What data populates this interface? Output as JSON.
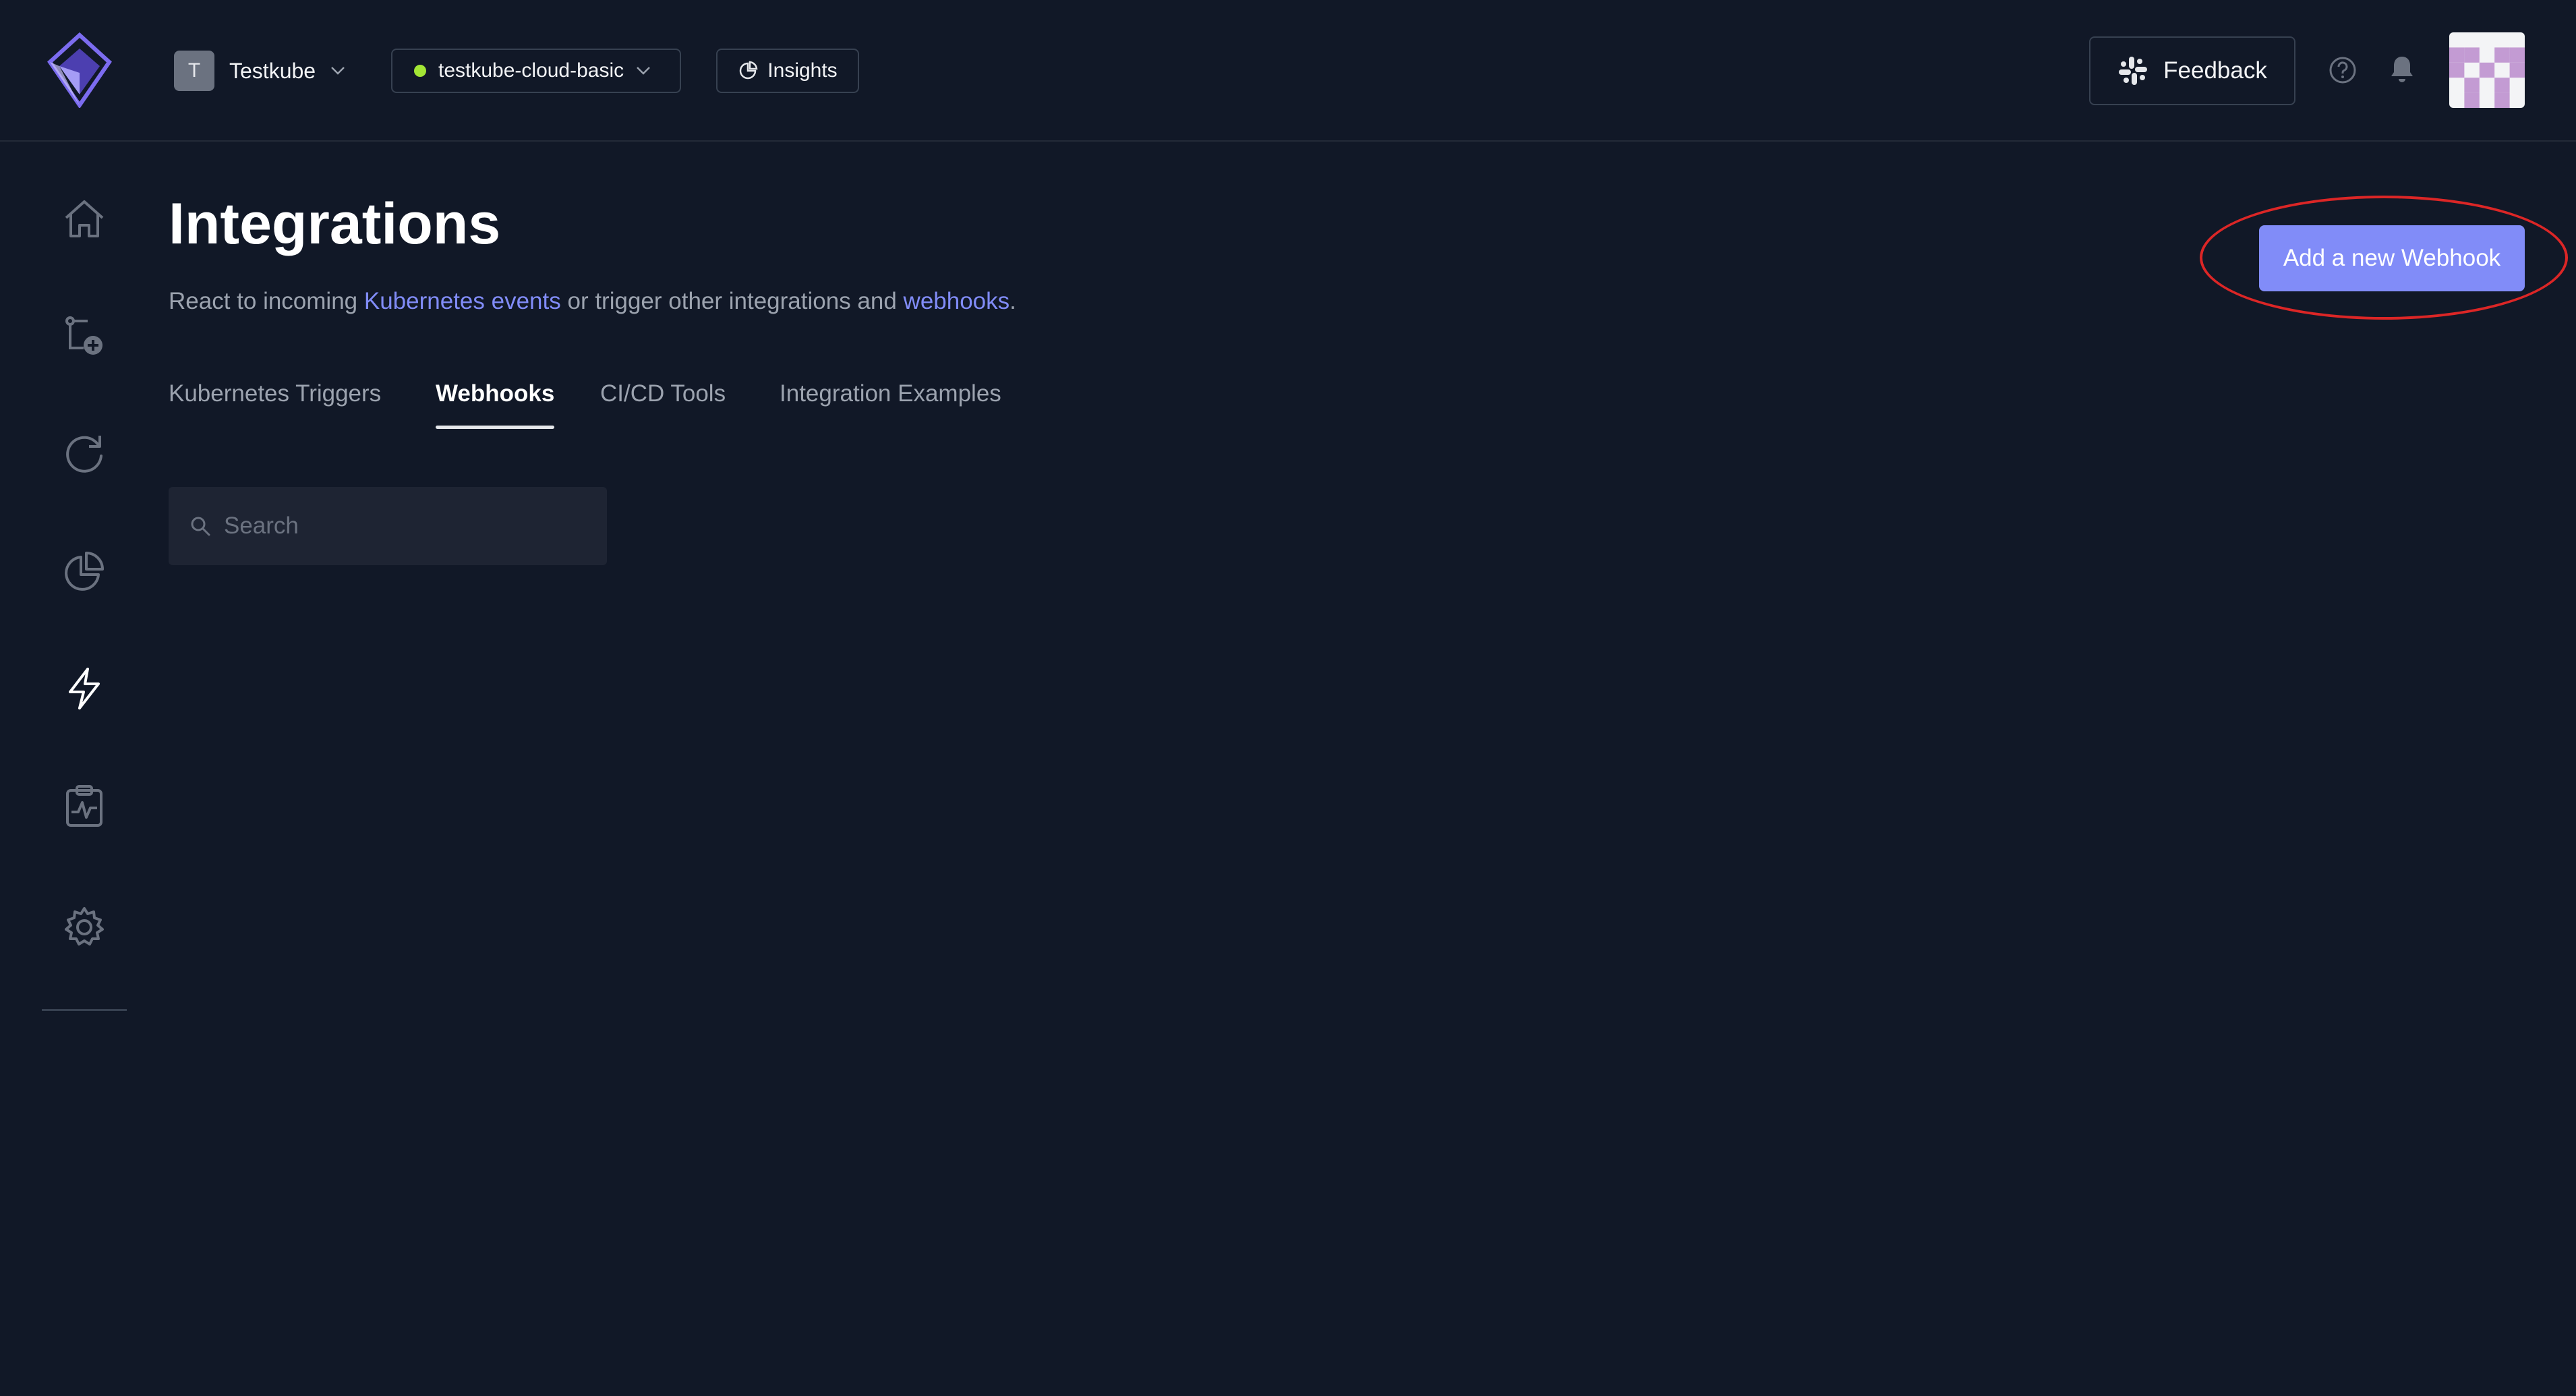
{
  "header": {
    "org": {
      "initial": "T",
      "name": "Testkube"
    },
    "environment": {
      "name": "testkube-cloud-basic",
      "status_color": "#a3e635"
    },
    "insights_label": "Insights",
    "feedback_label": "Feedback"
  },
  "sidebar": {
    "items": [
      {
        "name": "home",
        "icon": "home-icon"
      },
      {
        "name": "tests",
        "icon": "add-test-icon"
      },
      {
        "name": "executions",
        "icon": "refresh-icon"
      },
      {
        "name": "analytics",
        "icon": "pie-chart-icon"
      },
      {
        "name": "integrations",
        "icon": "lightning-icon",
        "active": true
      },
      {
        "name": "status",
        "icon": "clipboard-pulse-icon"
      },
      {
        "name": "settings",
        "icon": "gear-icon"
      }
    ]
  },
  "main": {
    "title": "Integrations",
    "subtitle": {
      "part1": "React to incoming ",
      "link1": "Kubernetes events",
      "part2": " or trigger other integrations and ",
      "link2": "webhooks",
      "part3": "."
    },
    "tabs": [
      {
        "label": "Kubernetes Triggers",
        "active": false
      },
      {
        "label": "Webhooks",
        "active": true
      },
      {
        "label": "CI/CD Tools",
        "active": false
      },
      {
        "label": "Integration Examples",
        "active": false
      }
    ],
    "search": {
      "placeholder": "Search",
      "value": ""
    },
    "add_button_label": "Add a new Webhook"
  },
  "colors": {
    "background": "#111827",
    "accent": "#818cf8",
    "highlight": "#dc2626"
  }
}
